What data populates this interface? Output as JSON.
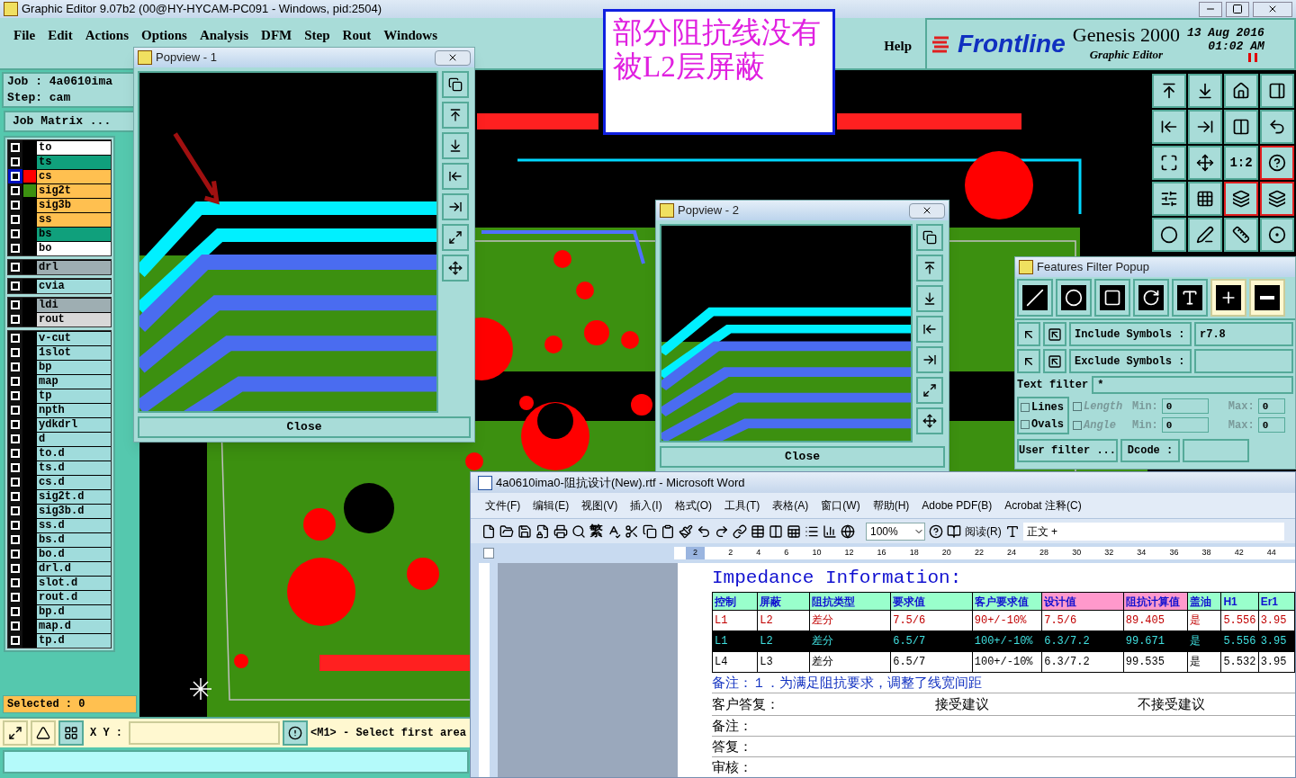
{
  "window": {
    "title": "Graphic Editor 9.07b2 (00@HY-HYCAM-PC091 - Windows, pid:2504)"
  },
  "menu": [
    "File",
    "Edit",
    "Actions",
    "Options",
    "Analysis",
    "DFM",
    "Step",
    "Rout",
    "Windows"
  ],
  "help": "Help",
  "brand": {
    "logo": "Frontline",
    "product": "Genesis 2000",
    "subtitle": "Graphic Editor",
    "date": "13 Aug 2016",
    "time": "01:02 AM"
  },
  "annotation": "部分阻抗线没有被L2层屏蔽",
  "job": {
    "job": "Job : 4a0610ima",
    "step": "Step: cam",
    "matrix": "Job Matrix ..."
  },
  "layer_groups": [
    {
      "layers": [
        {
          "name": "to",
          "kind": "silk",
          "selected": false
        },
        {
          "name": "ts",
          "kind": "mask",
          "selected": false
        },
        {
          "name": "cs",
          "kind": "signal",
          "selected": true,
          "color": "#ff0000"
        },
        {
          "name": "sig2t",
          "kind": "signal",
          "selected": false,
          "color": "#3c9010"
        },
        {
          "name": "sig3b",
          "kind": "signal",
          "selected": false
        },
        {
          "name": "ss",
          "kind": "signal",
          "selected": false
        },
        {
          "name": "bs",
          "kind": "mask",
          "selected": false
        },
        {
          "name": "bo",
          "kind": "silk",
          "selected": false
        }
      ]
    },
    {
      "layers": [
        {
          "name": "drl",
          "kind": "drill",
          "selected": false
        }
      ]
    },
    {
      "layers": [
        {
          "name": "cvia",
          "kind": "doc",
          "selected": false
        }
      ]
    },
    {
      "layers": [
        {
          "name": "ldi",
          "kind": "drill",
          "selected": false
        },
        {
          "name": "rout",
          "kind": "rout",
          "selected": false
        }
      ]
    },
    {
      "layers": [
        {
          "name": "v-cut",
          "kind": "doc",
          "selected": false
        },
        {
          "name": "1slot",
          "kind": "doc",
          "selected": false
        },
        {
          "name": "bp",
          "kind": "doc",
          "selected": false
        },
        {
          "name": "map",
          "kind": "doc",
          "selected": false
        },
        {
          "name": "tp",
          "kind": "doc",
          "selected": false
        },
        {
          "name": "npth",
          "kind": "doc",
          "selected": false
        },
        {
          "name": "ydkdrl",
          "kind": "doc",
          "selected": false
        },
        {
          "name": "d",
          "kind": "doc",
          "selected": false
        },
        {
          "name": "to.d",
          "kind": "doc",
          "selected": false
        },
        {
          "name": "ts.d",
          "kind": "doc",
          "selected": false
        },
        {
          "name": "cs.d",
          "kind": "doc",
          "selected": false
        },
        {
          "name": "sig2t.d",
          "kind": "doc",
          "selected": false
        },
        {
          "name": "sig3b.d",
          "kind": "doc",
          "selected": false
        },
        {
          "name": "ss.d",
          "kind": "doc",
          "selected": false
        },
        {
          "name": "bs.d",
          "kind": "doc",
          "selected": false
        },
        {
          "name": "bo.d",
          "kind": "doc",
          "selected": false
        },
        {
          "name": "drl.d",
          "kind": "doc",
          "selected": false
        },
        {
          "name": "slot.d",
          "kind": "doc",
          "selected": false
        },
        {
          "name": "rout.d",
          "kind": "doc",
          "selected": false
        },
        {
          "name": "bp.d",
          "kind": "doc",
          "selected": false
        },
        {
          "name": "map.d",
          "kind": "doc",
          "selected": false
        },
        {
          "name": "tp.d",
          "kind": "doc",
          "selected": false
        }
      ]
    }
  ],
  "selected_count": "Selected : 0",
  "toolbar": {
    "zoom_ratio": "1:2"
  },
  "bottom_bar": {
    "coords_label": "X Y :",
    "message": "<M1> - Select first area"
  },
  "popviews": [
    {
      "title": "Popview - 1",
      "close": "Close"
    },
    {
      "title": "Popview - 2",
      "close": "Close"
    }
  ],
  "features_filter": {
    "title": "Features Filter Popup",
    "include_label": "Include Symbols :",
    "include_value": "r7.8",
    "exclude_label": "Exclude Symbols :",
    "text_filter_label": "Text filter",
    "text_filter_value": "*",
    "types": [
      {
        "label": "Lines",
        "checked": false
      },
      {
        "label": "Ovals",
        "checked": false
      }
    ],
    "ranges": [
      {
        "label": "Length",
        "checked": false,
        "disabled": true,
        "min_label": "Min:",
        "min": "0",
        "max_label": "Max:",
        "max": "0"
      },
      {
        "label": "Angle",
        "checked": false,
        "disabled": true,
        "min_label": "Min:",
        "min": "0",
        "max_label": "Max:",
        "max": "0"
      }
    ],
    "user_filter": "User filter ...",
    "dcode_label": "Dcode :"
  },
  "word": {
    "title": "4a0610ima0-阻抗设计(New).rtf - Microsoft Word",
    "menu": [
      "文件(F)",
      "编辑(E)",
      "视图(V)",
      "插入(I)",
      "格式(O)",
      "工具(T)",
      "表格(A)",
      "窗口(W)",
      "帮助(H)",
      "Adobe PDF(B)",
      "Acrobat 注释(C)"
    ],
    "traditional": "繁",
    "zoom": "100%",
    "read": "阅读(R)",
    "style": "正文 + ",
    "ruler": [
      "2",
      "2",
      "4",
      "6",
      "10",
      "12",
      "16",
      "18",
      "20",
      "22",
      "24",
      "28",
      "30",
      "32",
      "34",
      "36",
      "38",
      "42",
      "44"
    ],
    "heading": "Impedance Information:",
    "columns": [
      {
        "label": "控制",
        "color": "#99ffcc"
      },
      {
        "label": "屏蔽",
        "color": "#99ffcc"
      },
      {
        "label": "阻抗类型",
        "color": "#99ffcc"
      },
      {
        "label": "要求值",
        "color": "#99ffcc"
      },
      {
        "label": "客户要求值",
        "color": "#99ffcc"
      },
      {
        "label": "设计值",
        "color": "#ff99cc"
      },
      {
        "label": "阻抗计算值",
        "color": "#ff99cc"
      },
      {
        "label": "盖油",
        "color": "#99ffcc"
      },
      {
        "label": "H1",
        "color": "#99ffcc"
      },
      {
        "label": "Er1",
        "color": "#99ffcc"
      }
    ],
    "rows": [
      {
        "selected": false,
        "color": "#c00000",
        "cells": [
          "L1",
          "L2",
          "差分",
          "7.5/6",
          "90+/-10%",
          "7.5/6",
          "89.405",
          "是",
          "5.556",
          "3.95"
        ]
      },
      {
        "selected": true,
        "color": "#000000",
        "cells": [
          "L1",
          "L2",
          "差分",
          "6.5/7",
          "100+/-10%",
          "6.3/7.2",
          "99.671",
          "是",
          "5.556",
          "3.95"
        ]
      },
      {
        "selected": false,
        "color": "#000000",
        "cells": [
          "L4",
          "L3",
          "差分",
          "6.5/7",
          "100+/-10%",
          "6.3/7.2",
          "99.535",
          "是",
          "5.532",
          "3.95"
        ]
      }
    ],
    "note": "备注：１．为满足阻抗要求，调整了线宽间距",
    "reply": {
      "label": "客户答复：",
      "accept": "接受建议",
      "reject": "不接受建议"
    },
    "lines": [
      "备注：",
      "答复：",
      "审核："
    ]
  }
}
